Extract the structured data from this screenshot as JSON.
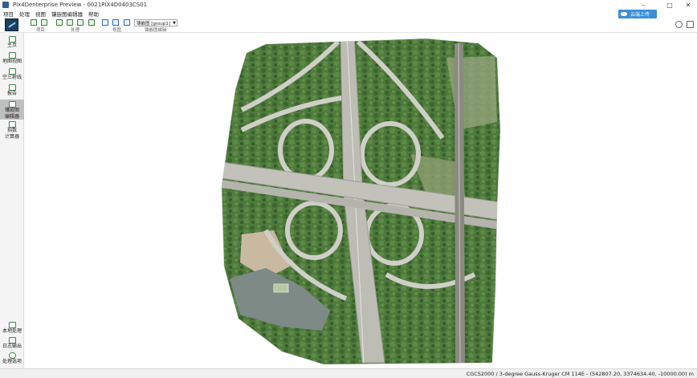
{
  "window": {
    "title": "Pix4Denterprise Preview - 0021PIX4D0403CS01",
    "controls": {
      "minimize": "–",
      "maximize": "□",
      "close": "✕"
    }
  },
  "menu": {
    "items": [
      "项目",
      "处理",
      "视图",
      "镶嵌图编辑器",
      "帮助"
    ]
  },
  "cloud_button": {
    "label": "云端上传",
    "color": "#3b8fd8"
  },
  "toolbar": {
    "group_labels": [
      "项目",
      "处理",
      "视图",
      "镶嵌图编辑"
    ],
    "mosaic_select": "镶嵌图 [group1]"
  },
  "sidebar": {
    "top_items": [
      {
        "label_1": "主页",
        "label_2": "",
        "icon": "home-icon"
      },
      {
        "label_1": "地图视图",
        "label_2": "",
        "icon": "map-view-icon"
      },
      {
        "label_1": "空三射线",
        "label_2": "",
        "icon": "ray-cloud-icon"
      },
      {
        "label_1": "报告",
        "label_2": "",
        "icon": "report-icon"
      },
      {
        "label_1": "镶嵌图",
        "label_2": "编辑器",
        "icon": "mosaic-editor-icon"
      },
      {
        "label_1": "指数",
        "label_2": "计算器",
        "icon": "index-calculator-icon"
      }
    ],
    "bottom_items": [
      {
        "label": "本地处理",
        "icon": "local-processing-icon"
      },
      {
        "label": "日志输出",
        "icon": "log-output-icon"
      },
      {
        "label": "处理选项",
        "icon": "processing-options-icon"
      }
    ]
  },
  "status": {
    "coordinates": "CGCS2000 / 3-degree Gauss-Kruger CM 114E - (542807.20, 3374634.40, -10000.00) m"
  },
  "colors": {
    "accent": "#3b8fd8",
    "vegetation": "#4f7a3e",
    "road": "#c9c9c4"
  }
}
